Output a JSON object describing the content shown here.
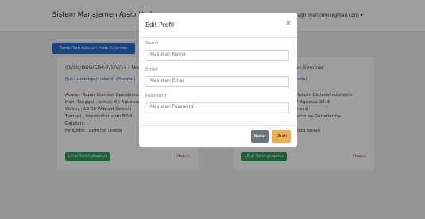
{
  "navbar": {
    "brand": "Sistem Manajemen Arsip Undanga",
    "user_email": "damaghriyantimo@gmail.com ▾"
  },
  "toolbar": {
    "toggle_label": "Tampilkan Sebuah Pada Kalender"
  },
  "cards": [
    {
      "title": "01/SU/DBO/6D4-7/5/V/14 - Unda",
      "link": "Buka undangan adalah (Fluri/bu)",
      "lines": [
        "Acara : Rapat Standar Operasional",
        "Hari, Tanggal : Jumat, 60 Agustus",
        "Waktu : 13.00 Wib s/d Selesai",
        "Tempat : Kesekretariatan BEM",
        "Catatan : -",
        "Pengirim : BEM FIP Unesa"
      ],
      "action": "Lihat Selengkapnya",
      "delete": "Hapus"
    },
    {
      "title": "an Seminar",
      "link": "terlaji",
      "lines": [
        "Hukum Bahasa Indonesia",
        "7 Agustus 2016",
        "elesai",
        "versitas Gunadarma",
        "",
        "Vata Kuliah"
      ],
      "action": "Lihat Selengkapnya",
      "delete": "Hapus"
    }
  ],
  "modal": {
    "title": "Edit Profil",
    "close": "×",
    "fields": [
      {
        "label": "Nama",
        "placeholder": "Masukan Nama"
      },
      {
        "label": "Email",
        "placeholder": "Masukan Email"
      },
      {
        "label": "Password",
        "placeholder": "Masukan Password"
      }
    ],
    "cancel_label": "Batal",
    "submit_label": "Ubah"
  }
}
